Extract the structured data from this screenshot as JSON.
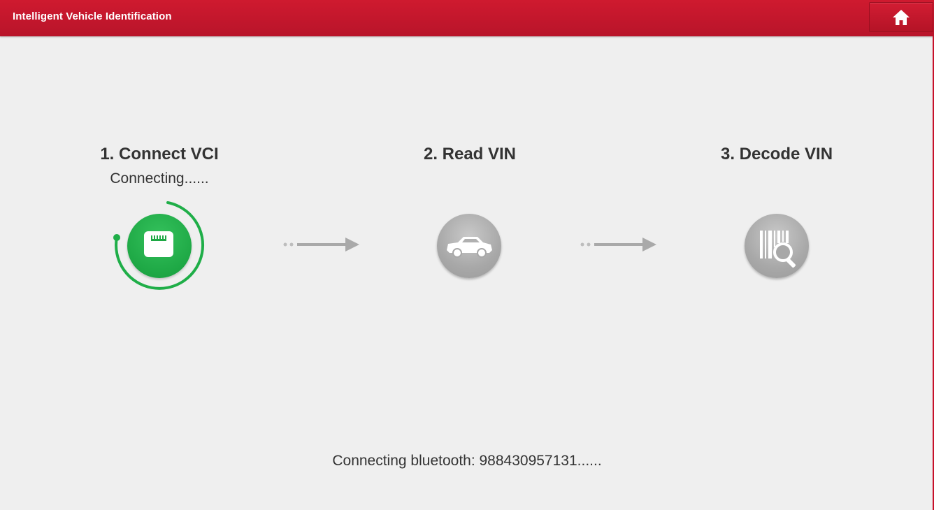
{
  "header": {
    "title": "Intelligent Vehicle Identification",
    "home_icon": "home-icon"
  },
  "steps": [
    {
      "title": "1. Connect VCI",
      "status": "Connecting......",
      "icon": "vci-connector-icon",
      "state": "active",
      "color": "#1ea845"
    },
    {
      "title": "2. Read VIN",
      "status": "",
      "icon": "car-icon",
      "state": "pending",
      "color": "#a8a8a8"
    },
    {
      "title": "3. Decode VIN",
      "status": "",
      "icon": "barcode-search-icon",
      "state": "pending",
      "color": "#a8a8a8"
    }
  ],
  "footer": {
    "message": "Connecting bluetooth: 988430957131......"
  },
  "colors": {
    "brand": "#c7112a",
    "active": "#1ea845",
    "inactive": "#a8a8a8",
    "background": "#efefef"
  }
}
